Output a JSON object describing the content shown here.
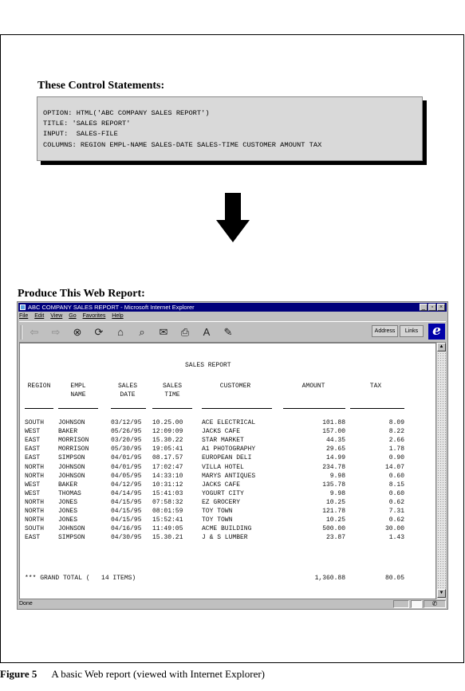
{
  "control_heading": "These Control Statements:",
  "control_lines": [
    "OPTION: HTML('ABC COMPANY SALES REPORT')",
    "TITLE: 'SALES REPORT'",
    "INPUT:  SALES-FILE",
    "COLUMNS: REGION EMPL-NAME SALES-DATE SALES-TIME CUSTOMER AMOUNT TAX"
  ],
  "produce_heading": "Produce This Web Report:",
  "browser": {
    "title": "ABC COMPANY SALES REPORT - Microsoft Internet Explorer",
    "menu": [
      "File",
      "Edit",
      "View",
      "Go",
      "Favorites",
      "Help"
    ],
    "address_label": "Address",
    "links_label": "Links",
    "status_text": "Done"
  },
  "report": {
    "title": "SALES REPORT",
    "headers": [
      [
        "",
        "REGION"
      ],
      [
        "EMPL",
        "NAME"
      ],
      [
        "SALES",
        "DATE"
      ],
      [
        "SALES",
        "TIME"
      ],
      [
        "",
        "CUSTOMER"
      ],
      [
        "",
        "AMOUNT"
      ],
      [
        "",
        "TAX"
      ]
    ],
    "rows": [
      [
        "SOUTH",
        "JOHNSON",
        "03/12/95",
        "10.25.00",
        "ACE ELECTRICAL",
        "101.88",
        "8.09"
      ],
      [
        "WEST",
        "BAKER",
        "05/26/95",
        "12:09:09",
        "JACKS CAFE",
        "157.00",
        "8.22"
      ],
      [
        "EAST",
        "MORRISON",
        "03/20/95",
        "15.30.22",
        "STAR MARKET",
        "44.35",
        "2.66"
      ],
      [
        "EAST",
        "MORRISON",
        "05/30/95",
        "19:05:41",
        "A1 PHOTOGRAPHY",
        "29.65",
        "1.78"
      ],
      [
        "EAST",
        "SIMPSON",
        "04/01/95",
        "08.17.57",
        "EUROPEAN DELI",
        "14.99",
        "0.90"
      ],
      [
        "NORTH",
        "JOHNSON",
        "04/01/95",
        "17:02:47",
        "VILLA HOTEL",
        "234.78",
        "14.07"
      ],
      [
        "NORTH",
        "JOHNSON",
        "04/05/95",
        "14:33:10",
        "MARYS ANTIQUES",
        "9.98",
        "0.60"
      ],
      [
        "WEST",
        "BAKER",
        "04/12/95",
        "10:31:12",
        "JACKS CAFE",
        "135.78",
        "8.15"
      ],
      [
        "WEST",
        "THOMAS",
        "04/14/95",
        "15:41:03",
        "YOGURT CITY",
        "9.98",
        "0.60"
      ],
      [
        "NORTH",
        "JONES",
        "04/15/95",
        "07:58:32",
        "EZ GROCERY",
        "10.25",
        "0.62"
      ],
      [
        "NORTH",
        "JONES",
        "04/15/95",
        "08:01:59",
        "TOY TOWN",
        "121.78",
        "7.31"
      ],
      [
        "NORTH",
        "JONES",
        "04/15/95",
        "15:52:41",
        "TOY TOWN",
        "10.25",
        "0.62"
      ],
      [
        "SOUTH",
        "JOHNSON",
        "04/16/95",
        "11:49:05",
        "ACME BUILDING",
        "500.00",
        "30.00"
      ],
      [
        "EAST",
        "SIMPSON",
        "04/30/95",
        "15.30.21",
        "J & S LUMBER",
        "23.87",
        "1.43"
      ]
    ],
    "total_label": "*** GRAND TOTAL (   14 ITEMS)",
    "total_amount": "1,360.88",
    "total_tax": "80.05"
  },
  "caption": {
    "label": "Figure 5",
    "text": "A basic Web report (viewed with Internet Explorer)"
  }
}
